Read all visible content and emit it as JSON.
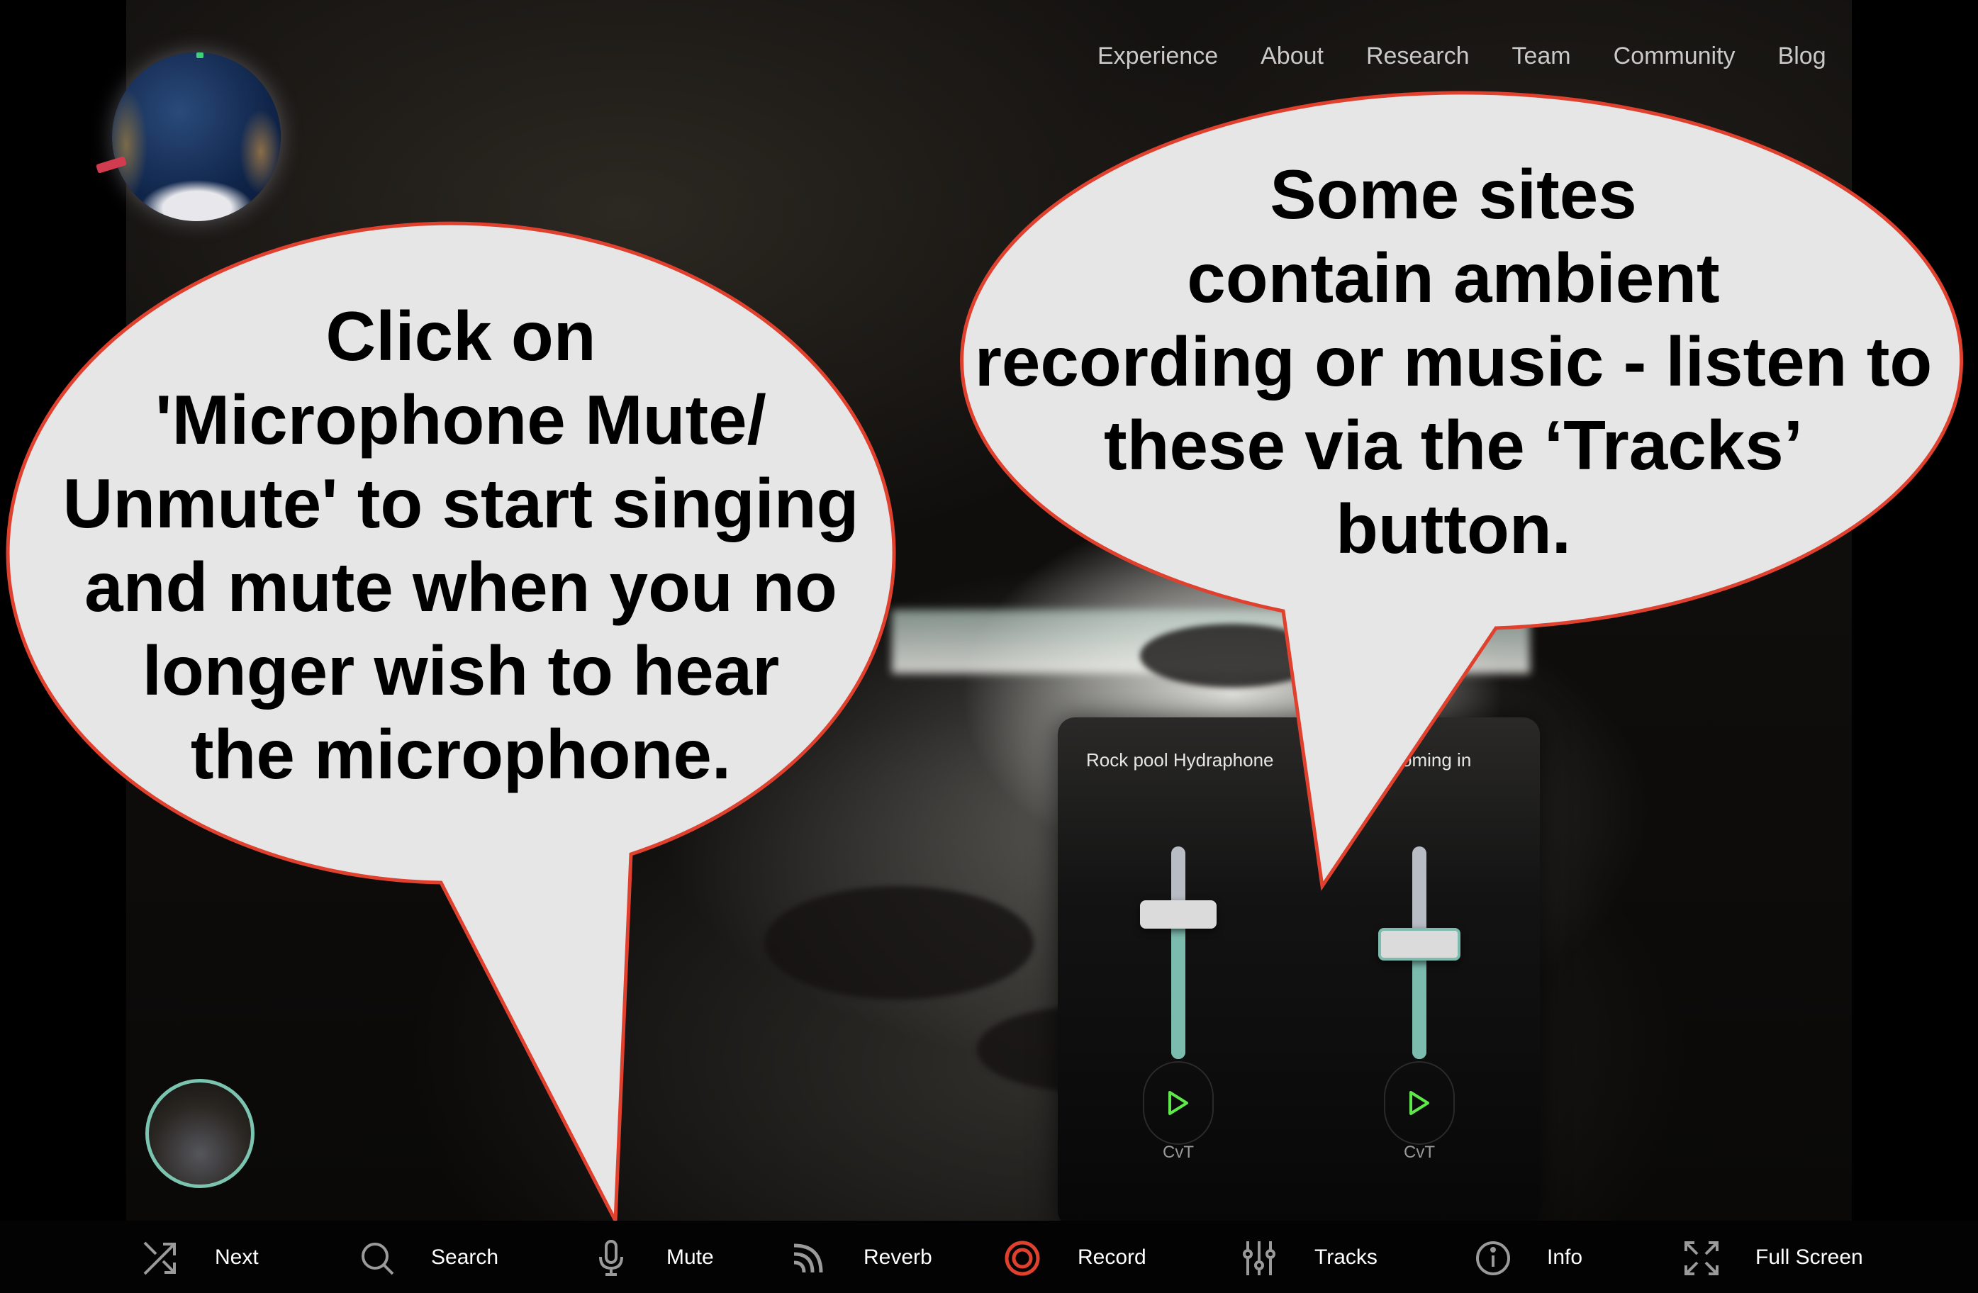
{
  "nav": {
    "items": [
      "Experience",
      "About",
      "Research",
      "Team",
      "Community",
      "Blog"
    ]
  },
  "globe": {
    "icon": "globe-icon"
  },
  "location_thumbnail": {
    "icon": "location-thumbnail"
  },
  "callouts": {
    "left": {
      "lines": [
        "Click on",
        "'Microphone Mute/",
        "Unmute' to start singing",
        "and mute when you no",
        "longer wish to hear",
        "the microphone."
      ]
    },
    "right": {
      "lines": [
        "Some sites",
        "contain ambient",
        "recording or music - listen to",
        "these via the ‘Tracks’",
        "button."
      ]
    },
    "fill_color": "#e6e6e6",
    "border_color": "#e0412e"
  },
  "tracks_panel": {
    "tracks": [
      {
        "title": "Rock pool Hydraphone",
        "volume": 0.68,
        "play_icon": "play-icon",
        "label": "CvT"
      },
      {
        "title": "coming in",
        "volume": 0.54,
        "play_icon": "play-icon",
        "label": "CvT"
      }
    ],
    "fill_color": "#7bbcae",
    "play_color": "#5ee84a"
  },
  "toolbar": {
    "items": [
      {
        "label": "Next",
        "icon": "shuffle-icon"
      },
      {
        "label": "Search",
        "icon": "search-icon"
      },
      {
        "label": "Mute",
        "icon": "microphone-icon"
      },
      {
        "label": "Reverb",
        "icon": "reverb-icon"
      },
      {
        "label": "Record",
        "icon": "record-icon",
        "color": "#e0412e"
      },
      {
        "label": "Tracks",
        "icon": "sliders-icon"
      },
      {
        "label": "Info",
        "icon": "info-icon"
      },
      {
        "label": "Full Screen",
        "icon": "fullscreen-icon"
      }
    ]
  }
}
